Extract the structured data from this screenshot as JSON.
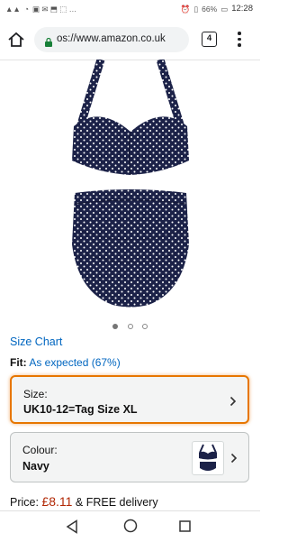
{
  "status": {
    "carrier_left": "..",
    "battery": "66%",
    "time": "12:28"
  },
  "browser": {
    "url": "os://www.amazon.co.uk",
    "tab_count": "4"
  },
  "gallery": {
    "image_count": 3,
    "active_index": 0
  },
  "product": {
    "size_chart_label": "Size Chart",
    "fit_label": "Fit:",
    "fit_value": "As expected (67%)",
    "size_label": "Size:",
    "size_value": "UK10-12=Tag Size XL",
    "colour_label": "Colour:",
    "colour_value": "Navy",
    "price_label": "Price:",
    "price_value": "£8.11",
    "delivery": "& FREE delivery"
  },
  "colors": {
    "link": "#0066c0",
    "price": "#b12704",
    "focus_border": "#e77600",
    "product_navy": "#1c2248"
  },
  "icons": [
    "home-icon",
    "lock-icon",
    "tab-switcher-icon",
    "overflow-menu-icon",
    "chevron-right-icon",
    "back-icon",
    "home-circle-icon",
    "recent-apps-icon"
  ]
}
